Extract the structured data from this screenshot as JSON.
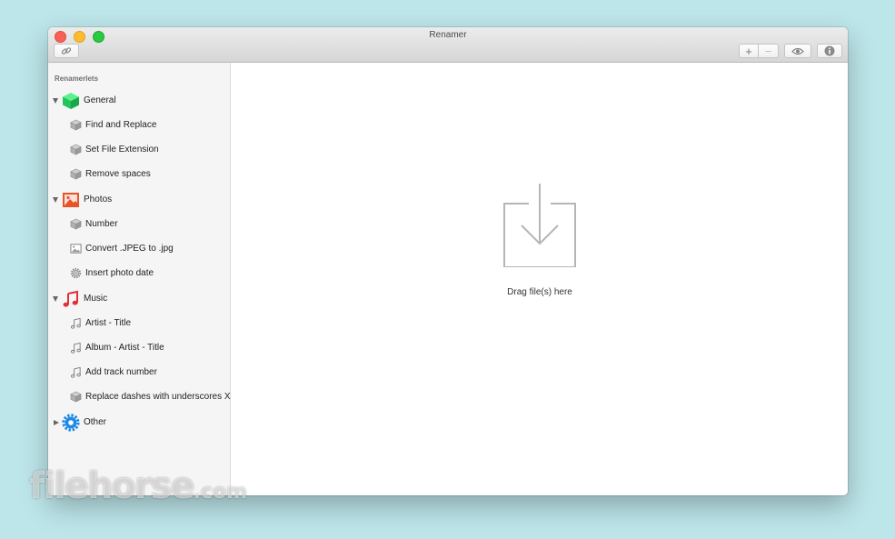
{
  "window": {
    "title": "Renamer"
  },
  "toolbar": {
    "add_label": "+",
    "remove_label": "−"
  },
  "sidebar": {
    "section_label": "Renamerlets",
    "groups": [
      {
        "label": "General",
        "icon": "green-cube-icon",
        "expanded": true,
        "items": [
          {
            "label": "Find and Replace",
            "icon": "cube-icon"
          },
          {
            "label": "Set File Extension",
            "icon": "cube-icon"
          },
          {
            "label": "Remove spaces",
            "icon": "cube-icon"
          }
        ]
      },
      {
        "label": "Photos",
        "icon": "photo-icon",
        "expanded": true,
        "items": [
          {
            "label": "Number",
            "icon": "cube-icon"
          },
          {
            "label": "Convert .JPEG to .jpg",
            "icon": "image-icon"
          },
          {
            "label": "Insert photo date",
            "icon": "gear-icon"
          }
        ]
      },
      {
        "label": "Music",
        "icon": "music-note-icon",
        "expanded": true,
        "items": [
          {
            "label": "Artist - Title",
            "icon": "music-note-icon"
          },
          {
            "label": "Album - Artist - Title",
            "icon": "music-note-icon"
          },
          {
            "label": "Add track number",
            "icon": "music-note-icon"
          },
          {
            "label": "Replace dashes with underscores X",
            "icon": "cube-icon"
          }
        ]
      },
      {
        "label": "Other",
        "icon": "blue-gear-icon",
        "expanded": false,
        "items": []
      }
    ],
    "bottom": {
      "add_label": "+",
      "settings_label": "⚙▾"
    }
  },
  "main": {
    "drop_label": "Drag file(s) here"
  },
  "watermark": {
    "text": "filehorse",
    "suffix": ".com"
  },
  "colors": {
    "background": "#bde6ea",
    "general_icon": "#2bd46a",
    "photos_icon": "#e8542a",
    "music_icon": "#e0303a",
    "other_icon": "#1e88e5"
  }
}
